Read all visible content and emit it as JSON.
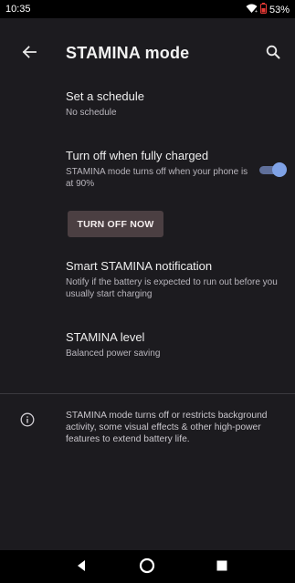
{
  "status_bar": {
    "time": "10:35",
    "battery": "53%",
    "icons": [
      "wifi-icon",
      "battery-icon"
    ]
  },
  "app_bar": {
    "title": "STAMINA mode",
    "back_icon": "arrow-left-icon",
    "search_icon": "search-icon"
  },
  "settings": {
    "schedule": {
      "title": "Set a schedule",
      "subtitle": "No schedule"
    },
    "fully_charged": {
      "title": "Turn off when fully charged",
      "subtitle": "STAMINA mode turns off when your phone is at 90%",
      "toggle_on": true
    },
    "turn_off_button": "TURN OFF NOW",
    "smart_notification": {
      "title": "Smart STAMINA notification",
      "subtitle": "Notify if the battery is expected to run out before you usually start charging"
    },
    "level": {
      "title": "STAMINA level",
      "subtitle": "Balanced power saving"
    }
  },
  "info": {
    "icon": "info-icon",
    "text": "STAMINA mode turns off or restricts background activity, some visual effects & other high-power features to extend battery life."
  },
  "nav_bar": {
    "buttons": [
      "back-triangle-icon",
      "home-circle-icon",
      "recents-square-icon"
    ]
  },
  "colors": {
    "background": "#1c1b1f",
    "toggle_thumb": "#7fa2e6",
    "button_bg": "#4b3f42",
    "battery_low": "#e53935"
  }
}
